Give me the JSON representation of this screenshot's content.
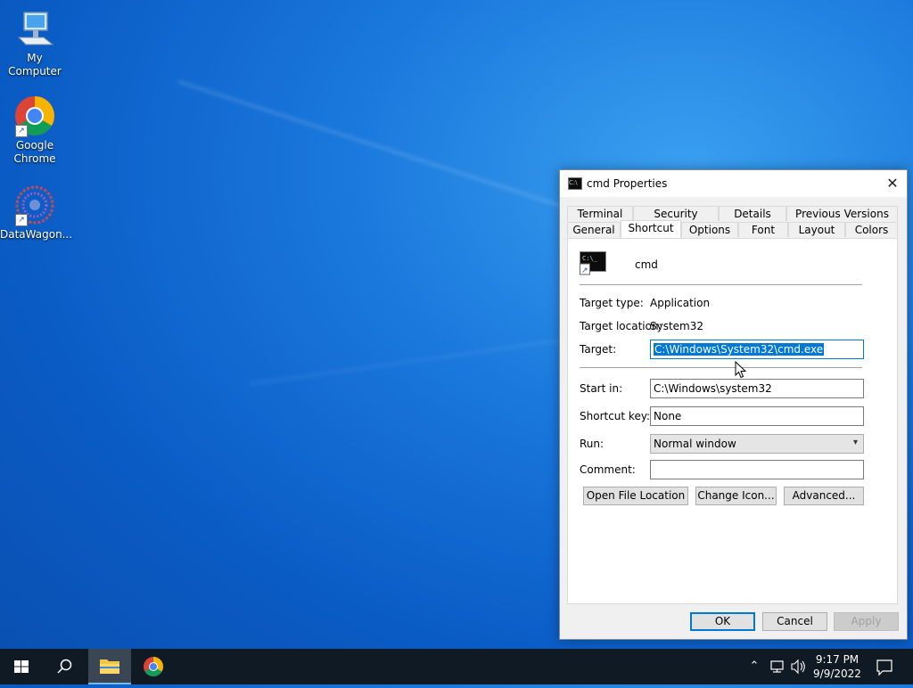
{
  "desktop": {
    "icons": [
      {
        "label": "My Computer",
        "icon": "computer-icon"
      },
      {
        "label": "Google Chrome",
        "icon": "chrome-icon"
      },
      {
        "label": "DataWagon...",
        "icon": "datawagon-icon"
      }
    ]
  },
  "dialog": {
    "title": "cmd Properties",
    "close_glyph": "✕",
    "tabs_row1": [
      "Terminal",
      "Security",
      "Details",
      "Previous Versions"
    ],
    "tabs_row2": [
      "General",
      "Shortcut",
      "Options",
      "Font",
      "Layout",
      "Colors"
    ],
    "active_tab": "Shortcut",
    "shortcut_name": "cmd",
    "target_type_label": "Target type:",
    "target_type_value": "Application",
    "target_location_label": "Target location:",
    "target_location_value": "System32",
    "target_label": "Target:",
    "target_value": "C:\\Windows\\System32\\cmd.exe",
    "start_in_label": "Start in:",
    "start_in_value": "C:\\Windows\\system32",
    "shortcut_key_label": "Shortcut key:",
    "shortcut_key_value": "None",
    "run_label": "Run:",
    "run_value": "Normal window",
    "comment_label": "Comment:",
    "comment_value": "",
    "btn_open_file_location": "Open File Location",
    "btn_change_icon": "Change Icon...",
    "btn_advanced": "Advanced...",
    "btn_ok": "OK",
    "btn_cancel": "Cancel",
    "btn_apply": "Apply"
  },
  "taskbar": {
    "time": "9:17 PM",
    "date": "9/9/2022"
  }
}
